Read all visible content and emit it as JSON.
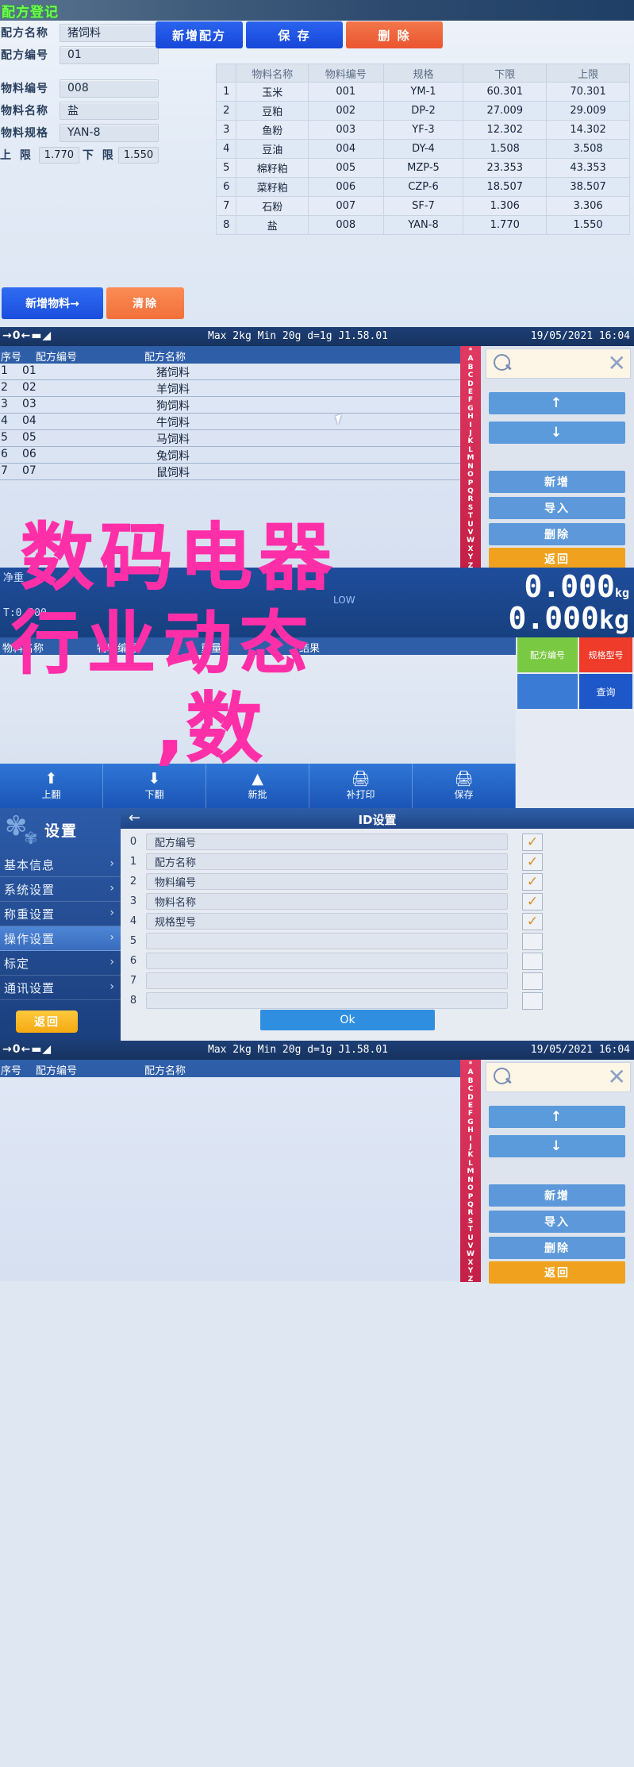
{
  "recipe_panel": {
    "title": "配方登记",
    "fields": [
      {
        "label": "配方名称",
        "value": "猪饲料"
      },
      {
        "label": "配方编号",
        "value": "01"
      },
      {
        "label": "物料编号",
        "value": "008"
      },
      {
        "label": "物料名称",
        "value": "盐"
      },
      {
        "label": "物料规格",
        "value": "YAN-8"
      }
    ],
    "limit_upper_label": "上  限",
    "limit_upper_value": "1.770",
    "limit_lower_label": "下  限",
    "limit_lower_value": "1.550",
    "buttons": {
      "new_recipe": "新增配方",
      "save": "保  存",
      "delete": "删  除",
      "add_material": "新增物料→",
      "clear": "清除"
    },
    "table": {
      "headers": [
        "",
        "物料名称",
        "物料编号",
        "规格",
        "下限",
        "上限"
      ],
      "rows": [
        [
          "1",
          "玉米",
          "001",
          "YM-1",
          "60.301",
          "70.301"
        ],
        [
          "2",
          "豆粕",
          "002",
          "DP-2",
          "27.009",
          "29.009"
        ],
        [
          "3",
          "鱼粉",
          "003",
          "YF-3",
          "12.302",
          "14.302"
        ],
        [
          "4",
          "豆油",
          "004",
          "DY-4",
          "1.508",
          "3.508"
        ],
        [
          "5",
          "棉籽粕",
          "005",
          "MZP-5",
          "23.353",
          "43.353"
        ],
        [
          "6",
          "菜籽粕",
          "006",
          "CZP-6",
          "18.507",
          "38.507"
        ],
        [
          "7",
          "石粉",
          "007",
          "SF-7",
          "1.306",
          "3.306"
        ],
        [
          "8",
          "盐",
          "008",
          "YAN-8",
          "1.770",
          "1.550"
        ]
      ]
    }
  },
  "scale_list": {
    "zero_indicator": "→0←▬◢",
    "meta": "Max 2kg  Min 20g  d=1g    J1.58.01",
    "datetime": "19/05/2021  16:04",
    "headers": [
      "序号",
      "配方编号",
      "配方名称"
    ],
    "rows": [
      [
        "1",
        "01",
        "猪饲料"
      ],
      [
        "2",
        "02",
        "羊饲料"
      ],
      [
        "3",
        "03",
        "狗饲料"
      ],
      [
        "4",
        "04",
        "牛饲料"
      ],
      [
        "5",
        "05",
        "马饲料"
      ],
      [
        "6",
        "06",
        "兔饲料"
      ],
      [
        "7",
        "07",
        "鼠饲料"
      ]
    ],
    "alpha_index": "*ABCDEFGHIJKLMNOPQRSTUVWXYZ",
    "search_placeholder": "",
    "side_buttons": {
      "page_up": "↑",
      "page_down": "↓",
      "add": "新增",
      "import": "导入",
      "delete": "删除",
      "back": "返回"
    }
  },
  "weigh_panel": {
    "tare_label": "T:0.000",
    "net_label": "净重",
    "low_label": "LOW",
    "weight_main": "0.000",
    "weight_unit": "kg",
    "weight_second": "0.000",
    "headers": [
      "物料名称",
      "物料编号",
      "重量",
      "结果"
    ],
    "side_buttons": {
      "recipe_no": "配方编号",
      "model_no": "规格型号",
      "query": "查询"
    },
    "toolbar": [
      {
        "icon": "up-arrow",
        "label": "上翻"
      },
      {
        "icon": "down-arrow",
        "label": "下翻"
      },
      {
        "icon": "stack",
        "label": "新批"
      },
      {
        "icon": "printer",
        "label": "补打印"
      },
      {
        "icon": "printer-plus",
        "label": "保存"
      }
    ]
  },
  "settings_panel": {
    "title": "设置",
    "menu": [
      {
        "label": "基本信息",
        "selected": false
      },
      {
        "label": "系统设置",
        "selected": false
      },
      {
        "label": "称重设置",
        "selected": false
      },
      {
        "label": "操作设置",
        "selected": true
      },
      {
        "label": "标定",
        "selected": false
      },
      {
        "label": "通讯设置",
        "selected": false
      }
    ],
    "back_button": "返回",
    "detail_title": "ID设置",
    "back_icon": "←",
    "rows": [
      {
        "n": "0",
        "value": "配方编号",
        "checked": true
      },
      {
        "n": "1",
        "value": "配方名称",
        "checked": true
      },
      {
        "n": "2",
        "value": "物料编号",
        "checked": true
      },
      {
        "n": "3",
        "value": "物料名称",
        "checked": true
      },
      {
        "n": "4",
        "value": "规格型号",
        "checked": true
      },
      {
        "n": "5",
        "value": "",
        "checked": false
      },
      {
        "n": "6",
        "value": "",
        "checked": false
      },
      {
        "n": "7",
        "value": "",
        "checked": false
      },
      {
        "n": "8",
        "value": "",
        "checked": false
      }
    ],
    "ok_button": "Ok"
  },
  "overlay": {
    "line1": "数码电器",
    "line2": "行业动态",
    "line3": ",数"
  }
}
